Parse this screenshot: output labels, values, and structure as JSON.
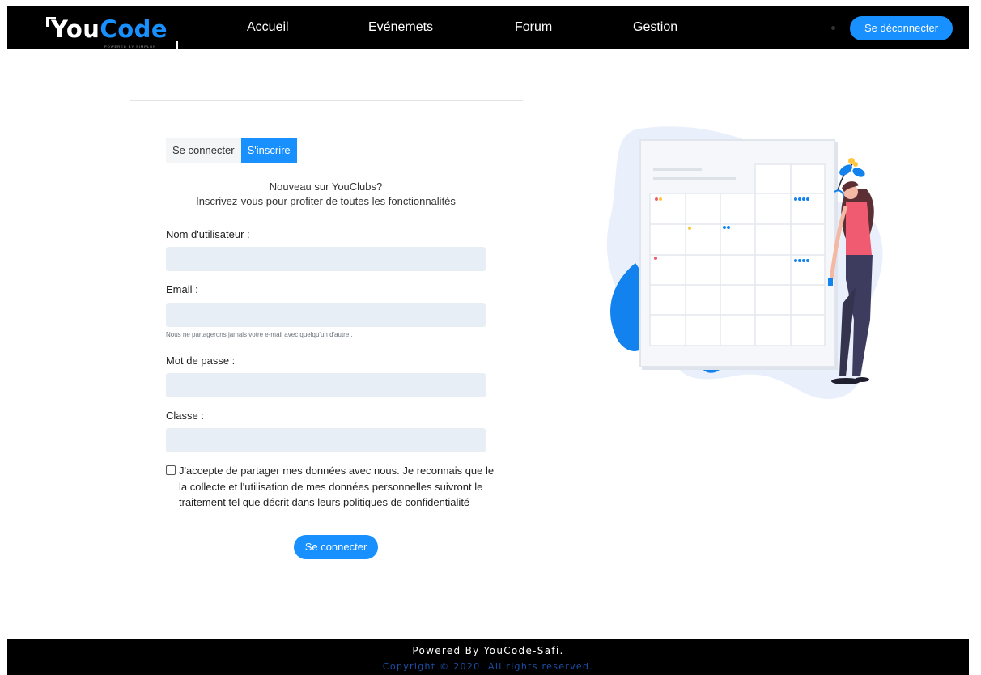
{
  "navbar": {
    "logo": {
      "text_plain": "You",
      "text_accent": "Code",
      "tagline": "POWERED BY SIMPLON"
    },
    "links": [
      {
        "label": "Accueil"
      },
      {
        "label": "Evénemets"
      },
      {
        "label": "Forum"
      },
      {
        "label": "Gestion"
      }
    ],
    "logout_label": "Se déconnecter"
  },
  "form": {
    "tabs": [
      {
        "label": "Se connecter",
        "active": false
      },
      {
        "label": "S'inscrire",
        "active": true
      }
    ],
    "intro_line1": "Nouveau sur YouClubs?",
    "intro_line2": "Inscrivez-vous pour profiter de toutes les fonctionnalités",
    "fields": [
      {
        "label": "Nom d'utilisateur :",
        "value": ""
      },
      {
        "label": "Email :",
        "value": ""
      },
      {
        "label": "Mot de passe :",
        "value": ""
      },
      {
        "label": "Classe :",
        "value": ""
      }
    ],
    "email_hint": "Nous ne partagerons jamais votre e-mail avec quelqu'un d'autre .",
    "consent_checked": false,
    "consent_text": "J'accepte de partager mes données avec nous. Je reconnais que le la collecte et l'utilisation de mes données personnelles suivront le traitement tel que décrit dans leurs politiques de confidentialité",
    "submit_label": "Se connecter"
  },
  "footer": {
    "powered": "Powered By YouCode-Safi.",
    "copyright": "Copyright © 2020. All rights reserved."
  },
  "colors": {
    "accent": "#1890ff",
    "navbar_bg": "#000000",
    "input_bg": "#e8eef6"
  }
}
